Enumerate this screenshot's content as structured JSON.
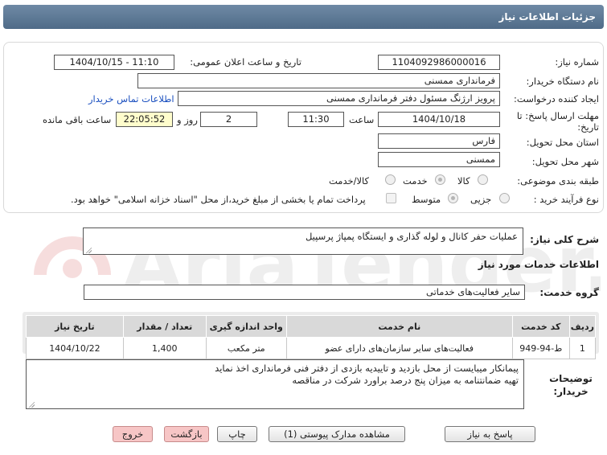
{
  "title": "جزئیات اطلاعات نیاز",
  "fields": {
    "need_number_label": "شماره نیاز:",
    "need_number": "1104092986000016",
    "announce_label": "تاریخ و ساعت اعلان عمومی:",
    "announce_value": "1404/10/15 - 11:10",
    "buyer_org_label": "نام دستگاه خریدار:",
    "buyer_org": "فرمانداری ممسنی",
    "creator_label": "ایجاد کننده درخواست:",
    "creator": "پرویز ارژنگ مسئول دفتر فرمانداری ممسنی",
    "contact_link": "اطلاعات تماس خریدار",
    "deadline_label": "مهلت ارسال پاسخ: تا تاریخ:",
    "deadline_date": "1404/10/18",
    "time_label": "ساعت",
    "deadline_time": "11:30",
    "days_value": "2",
    "days_label": "روز و",
    "remaining_time": "22:05:52",
    "remaining_label": "ساعت باقی مانده",
    "province_label": "استان محل تحویل:",
    "province": "فارس",
    "city_label": "شهر محل تحویل:",
    "city": "ممسنی",
    "category_label": "طبقه بندی موضوعی:",
    "category_options": [
      "کالا",
      "خدمت",
      "کالا/خدمت"
    ],
    "process_label": "نوع فرآیند خرید :",
    "process_options": [
      "جزیی",
      "متوسط"
    ],
    "payment_note": "پرداخت تمام یا بخشی از مبلغ خرید،از محل \"اسناد خزانه اسلامی\" خواهد بود."
  },
  "summary_label": "شرح کلی نیاز:",
  "summary": "عملیات حفر کانال و لوله گذاری و ایستگاه پمپاژ پرسپیل",
  "services_header": "اطلاعات خدمات مورد نیاز",
  "service_group_label": "گروه خدمت:",
  "service_group": "سایر فعالیت‌های خدماتی",
  "table": {
    "headers": [
      "ردیف",
      "کد خدمت",
      "نام خدمت",
      "واحد اندازه گیری",
      "تعداد / مقدار",
      "تاریخ نیاز"
    ],
    "rows": [
      [
        "1",
        "ط-94-949",
        "فعالیت‌های سایر سازمان‌های دارای عضو",
        "متر مکعب",
        "1,400",
        "1404/10/22"
      ]
    ]
  },
  "buyer_notes_label": "توضیحات خریدار:",
  "buyer_notes": [
    "پیمانکار میبایست از محل بازدید و تاییدیه بازدی از دفتر فنی فرمانداری اخذ نماید",
    "تهیه ضمانتنامه به میزان پنج درصد براورد شرکت در مناقصه"
  ],
  "buttons": {
    "reply": "پاسخ به نیاز",
    "attachments": "مشاهده مدارک پیوستی (1)",
    "print": "چاپ",
    "back": "بازگشت",
    "exit": "خروج"
  },
  "watermark_text": "AriaTender.net",
  "colors": {
    "title_bar": "#5a7594",
    "highlight": "#fffdcc",
    "link": "#1a4fbf",
    "pink_button": "#f7c6c6"
  }
}
